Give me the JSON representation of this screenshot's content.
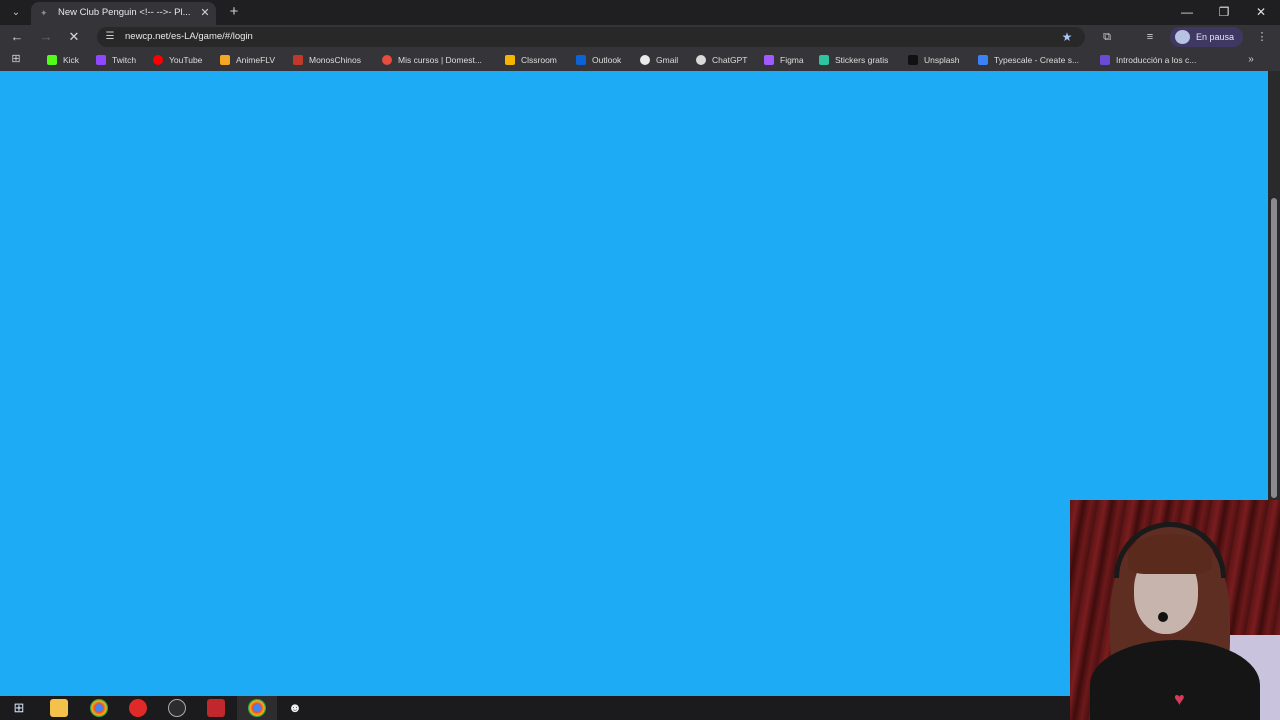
{
  "browser": {
    "tab": {
      "title": "New Club Penguin <!-- -->- Pl...",
      "favicon": "club-penguin-icon"
    },
    "address_bar": {
      "url": "newcp.net/es-LA/game/#/login"
    },
    "profile": {
      "label": "En pausa"
    },
    "bookmarks": [
      {
        "label": "Kick",
        "color": "#53fc18"
      },
      {
        "label": "Twitch",
        "color": "#9146ff"
      },
      {
        "label": "YouTube",
        "color": "#ff0000"
      },
      {
        "label": "AnimeFLV",
        "color": "#f5a623"
      },
      {
        "label": "MonosChinos",
        "color": "#c0392b"
      },
      {
        "label": "Mis cursos | Domest...",
        "color": "#e74c3c"
      },
      {
        "label": "Clssroom",
        "color": "#f4b400"
      },
      {
        "label": "Outlook",
        "color": "#0a64d8"
      },
      {
        "label": "Gmail",
        "color": "#eaeaea"
      },
      {
        "label": "ChatGPT",
        "color": "#d9d9d9"
      },
      {
        "label": "Figma",
        "color": "#a259ff"
      },
      {
        "label": "Stickers gratis",
        "color": "#2ec4a0"
      },
      {
        "label": "Unsplash",
        "color": "#111111"
      },
      {
        "label": "Typescale - Create s...",
        "color": "#3b82f6"
      },
      {
        "label": "Introducción a los c...",
        "color": "#6c4ad8"
      }
    ]
  },
  "page": {
    "background": "#1dabf5"
  },
  "taskbar": {
    "icons": [
      "windows-start-icon",
      "file-explorer-icon",
      "chrome-icon",
      "red-app-icon",
      "steam-icon",
      "voice-app-icon",
      "chrome-active-icon",
      "discord-icon"
    ]
  }
}
